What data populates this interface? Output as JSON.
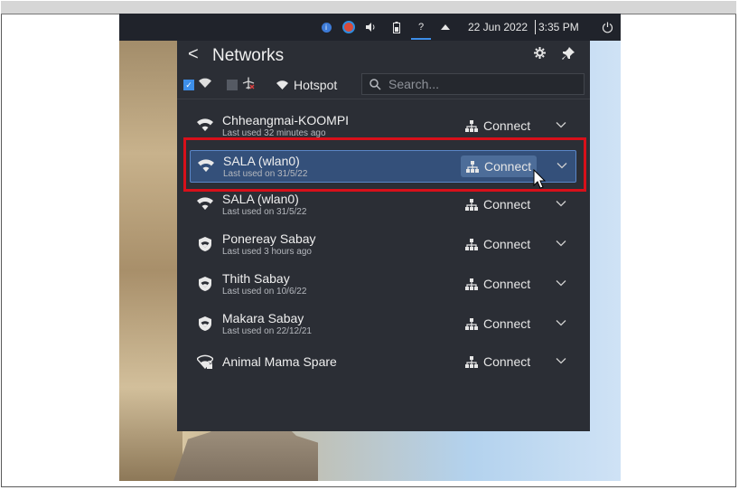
{
  "taskbar": {
    "date": "22 Jun 2022",
    "time": "3:35 PM",
    "icons": [
      "info-icon",
      "browser-icon",
      "volume-icon",
      "battery-icon",
      "network-unknown-icon",
      "tray-expand-icon",
      "power-icon"
    ],
    "network_glyph": "?",
    "info_glyph": "i"
  },
  "panel": {
    "title": "Networks",
    "back_glyph": "<",
    "settings_glyph": "✹",
    "pin_glyph": "📌"
  },
  "filters": {
    "wifi_checked": true,
    "airplane_checked": false,
    "hotspot_label": "Hotspot",
    "search_placeholder": "Search..."
  },
  "networks": [
    {
      "name": "Chheangmai-KOOMPI",
      "sub": "Last used 32 minutes ago",
      "action": "Connect",
      "secure": false
    },
    {
      "name": "SALA (wlan0)",
      "sub": "Last used on 31/5/22",
      "action": "Connect",
      "secure": false,
      "selected": true
    },
    {
      "name": "SALA (wlan0)",
      "sub": "Last used on 31/5/22",
      "action": "Connect",
      "secure": false
    },
    {
      "name": "Ponereay Sabay",
      "sub": "Last used 3 hours ago",
      "action": "Connect",
      "secure": true
    },
    {
      "name": "Thith Sabay",
      "sub": "Last used on 10/6/22",
      "action": "Connect",
      "secure": true
    },
    {
      "name": "Makara Sabay",
      "sub": "Last used on 22/12/21",
      "action": "Connect",
      "secure": true
    },
    {
      "name": "Animal Mama Spare",
      "sub": "",
      "action": "Connect",
      "secure": false,
      "locked": true
    }
  ],
  "colors": {
    "panel_bg": "#2b2e35",
    "taskbar_bg": "#20232b",
    "selected_row": "#34507a",
    "highlight": "#d8101a",
    "accent": "#3d8ee8"
  }
}
